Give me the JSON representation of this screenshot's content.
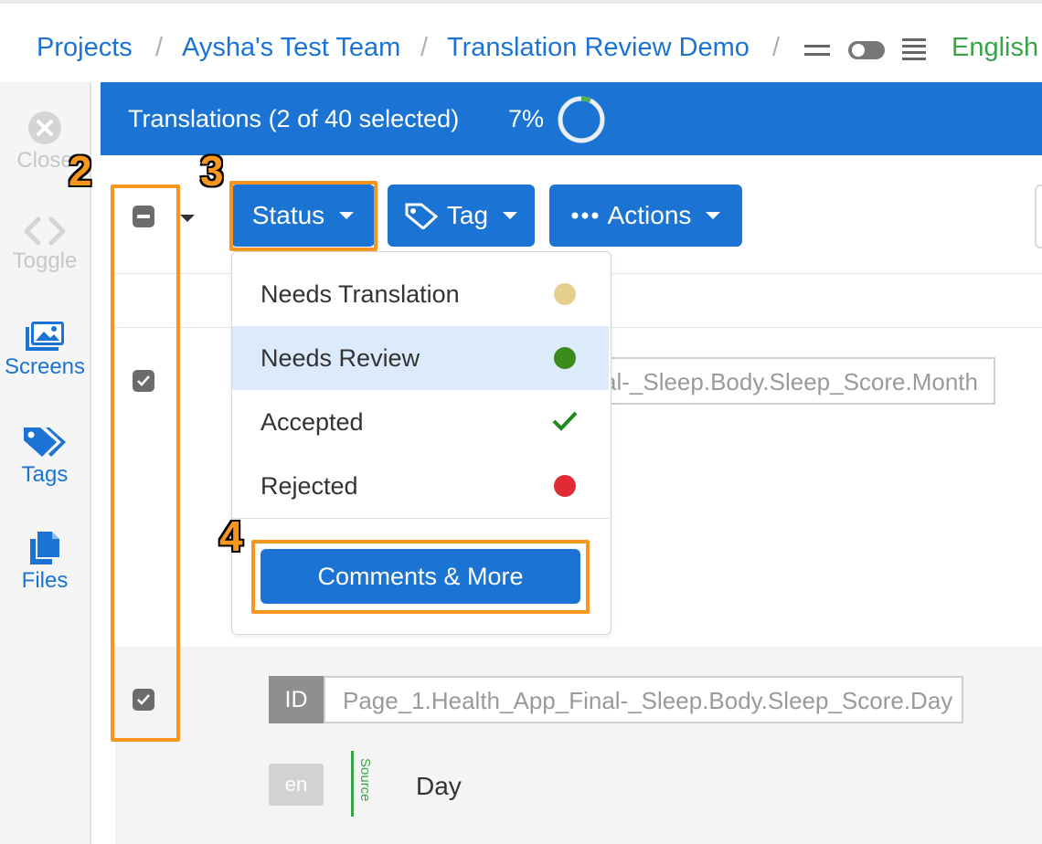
{
  "breadcrumb": {
    "items": [
      "Projects",
      "Aysha's Test Team",
      "Translation Review Demo"
    ],
    "separator": "/",
    "language": "English"
  },
  "sidebar": {
    "items": [
      {
        "label": "Close",
        "icon": "close-circle-icon"
      },
      {
        "label": "Toggle",
        "icon": "code-brackets-icon"
      },
      {
        "label": "Screens",
        "icon": "images-icon"
      },
      {
        "label": "Tags",
        "icon": "tags-icon"
      },
      {
        "label": "Files",
        "icon": "files-icon"
      }
    ]
  },
  "header": {
    "title": "Translations (2 of 40 selected)",
    "progress_text": "7%",
    "progress": 0.07
  },
  "toolbar": {
    "status_label": "Status",
    "tag_label": "Tag",
    "actions_label": "Actions"
  },
  "status_menu": {
    "items": [
      {
        "label": "Needs Translation",
        "indicator": "dot",
        "color": "#e6d08e"
      },
      {
        "label": "Needs Review",
        "indicator": "dot",
        "color": "#3a8a1c",
        "highlighted": true
      },
      {
        "label": "Accepted",
        "indicator": "check",
        "color": "#1e8a1e"
      },
      {
        "label": "Rejected",
        "indicator": "dot",
        "color": "#e02a35"
      }
    ],
    "comments_button": "Comments & More"
  },
  "rows": [
    {
      "id_value": "Page_1.Health_App_Final-_Sleep.Body.Sleep_Score.Month",
      "id_visible": "al-_Sleep.Body.Sleep_Score.Month",
      "checked": true
    },
    {
      "id_badge": "ID",
      "id_value": "Page_1.Health_App_Final-_Sleep.Body.Sleep_Score.Day",
      "checked": true,
      "lang_code": "en",
      "source_label": "Source",
      "source_text": "Day"
    }
  ],
  "callouts": [
    "2",
    "3",
    "4"
  ],
  "colors": {
    "primary": "#1b74d3",
    "callout": "#f7961e",
    "language": "#3aa34a"
  }
}
